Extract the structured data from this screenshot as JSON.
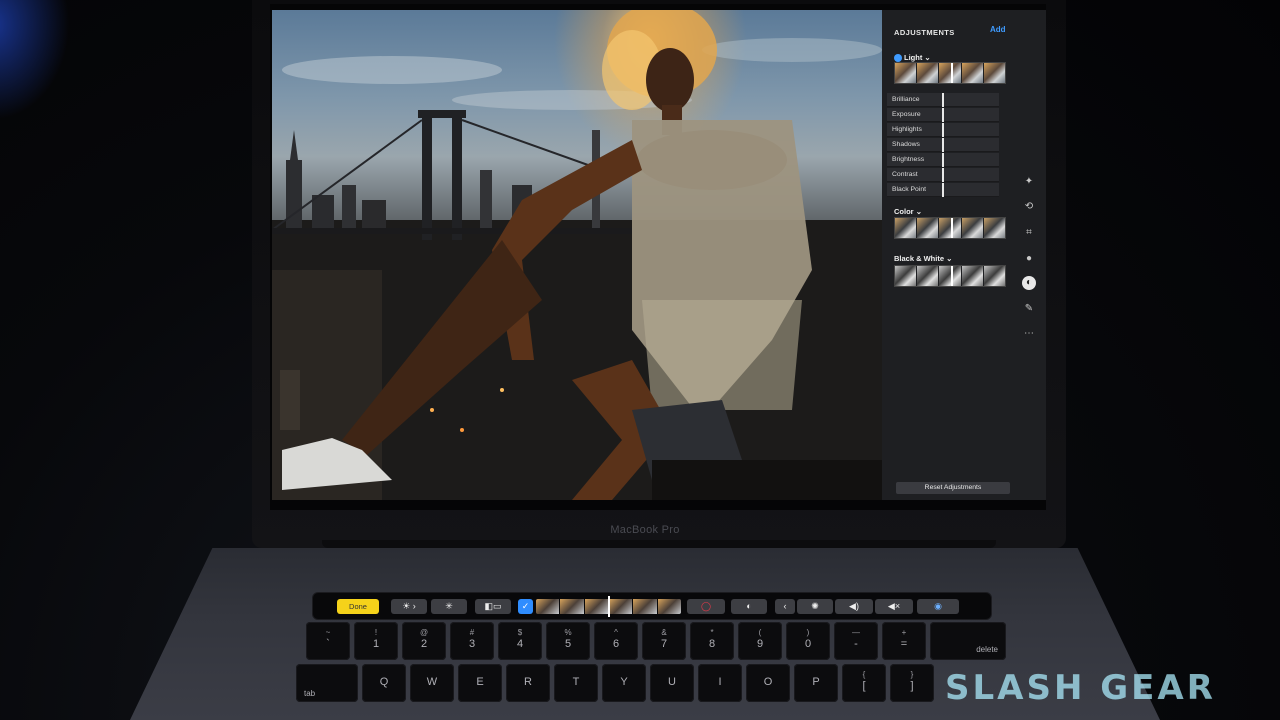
{
  "device": {
    "label": "MacBook Pro"
  },
  "panel": {
    "title": "ADJUSTMENTS",
    "add_label": "Add",
    "sections": [
      {
        "label": "Light",
        "chevron": "⌄"
      },
      {
        "label": "Color",
        "chevron": "⌄"
      },
      {
        "label": "Black & White",
        "chevron": "⌄"
      }
    ],
    "light_sliders": [
      "Brilliance",
      "Exposure",
      "Highlights",
      "Shadows",
      "Brightness",
      "Contrast",
      "Black Point"
    ],
    "reset_label": "Reset Adjustments",
    "tools": [
      "magic-wand-icon",
      "rotate-icon",
      "crop-icon",
      "filters-icon",
      "adjust-icon",
      "retouch-icon",
      "more-icon"
    ]
  },
  "touchbar": {
    "done_label": "Done",
    "controls": [
      {
        "name": "brightness-icon",
        "glyph": "☀ ›"
      },
      {
        "name": "enhance-icon",
        "glyph": "✳"
      },
      {
        "name": "compare-icon",
        "glyph": "◧▭"
      },
      {
        "name": "color-wheel-icon",
        "glyph": "◯"
      },
      {
        "name": "contrast-icon",
        "glyph": "◐"
      },
      {
        "name": "expand-icon",
        "glyph": "‹"
      },
      {
        "name": "screen-brightness-icon",
        "glyph": "✺"
      },
      {
        "name": "volume-icon",
        "glyph": "◀)"
      },
      {
        "name": "mute-icon",
        "glyph": "◀×"
      },
      {
        "name": "siri-icon",
        "glyph": "◉"
      }
    ],
    "check_glyph": "✓"
  },
  "keyboard": {
    "number_row": [
      {
        "top": "~",
        "bottom": "`"
      },
      {
        "top": "!",
        "bottom": "1"
      },
      {
        "top": "@",
        "bottom": "2"
      },
      {
        "top": "#",
        "bottom": "3"
      },
      {
        "top": "$",
        "bottom": "4"
      },
      {
        "top": "%",
        "bottom": "5"
      },
      {
        "top": "^",
        "bottom": "6"
      },
      {
        "top": "&",
        "bottom": "7"
      },
      {
        "top": "*",
        "bottom": "8"
      },
      {
        "top": "(",
        "bottom": "9"
      },
      {
        "top": ")",
        "bottom": "0"
      },
      {
        "top": "—",
        "bottom": "-"
      },
      {
        "top": "+",
        "bottom": "="
      }
    ],
    "delete_label": "delete",
    "tab_label": "tab",
    "letter_row": [
      "Q",
      "W",
      "E",
      "R",
      "T",
      "Y",
      "U",
      "I",
      "O",
      "P"
    ],
    "bracket_key": {
      "top": "{",
      "bottom": "["
    },
    "bracket_close_key": {
      "top": "}",
      "bottom": "]"
    }
  },
  "watermark": {
    "text": "SLASH GEAR"
  }
}
